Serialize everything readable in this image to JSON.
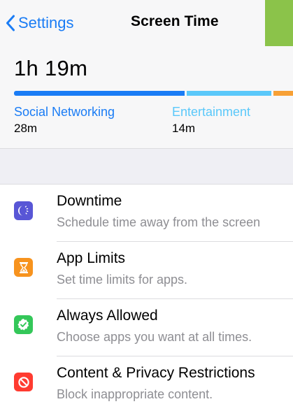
{
  "nav": {
    "back_label": "Settings",
    "title": "Screen Time"
  },
  "summary": {
    "total_time": "1h 19m",
    "categories": [
      {
        "name": "Social Networking",
        "time": "28m",
        "color": "#1a7cf5"
      },
      {
        "name": "Entertainment",
        "time": "14m",
        "color": "#5ac8fa"
      }
    ],
    "other_color": "#f7a035"
  },
  "items": [
    {
      "title": "Downtime",
      "subtitle": "Schedule time away from the screen",
      "icon": "moon-clock-icon",
      "color": "#5856d6"
    },
    {
      "title": "App Limits",
      "subtitle": "Set time limits for apps.",
      "icon": "hourglass-icon",
      "color": "#f7931e"
    },
    {
      "title": "Always Allowed",
      "subtitle": "Choose apps you want at all times.",
      "icon": "checkmark-badge-icon",
      "color": "#34c759"
    },
    {
      "title": "Content & Privacy Restrictions",
      "subtitle": "Block inappropriate content.",
      "icon": "restriction-icon",
      "color": "#ff3b30"
    }
  ]
}
